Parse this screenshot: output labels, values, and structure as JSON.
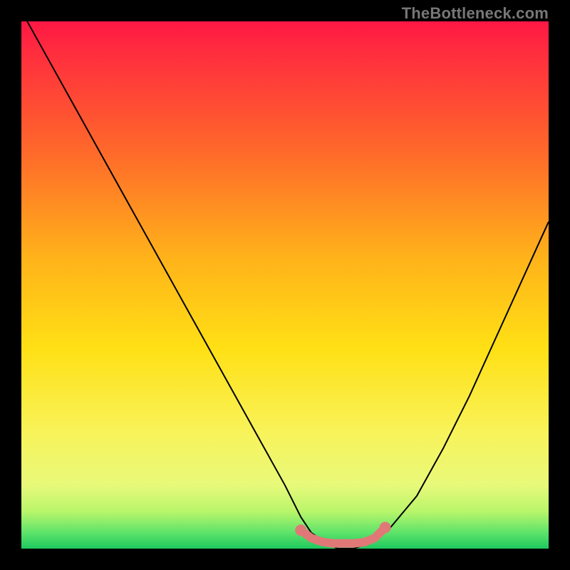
{
  "watermark": "TheBottleneck.com",
  "chart_data": {
    "type": "line",
    "title": "",
    "xlabel": "",
    "ylabel": "",
    "xlim": [
      0,
      100
    ],
    "ylim": [
      0,
      100
    ],
    "series": [
      {
        "name": "bottleneck-curve",
        "x": [
          0,
          5,
          10,
          15,
          20,
          25,
          30,
          35,
          40,
          45,
          50,
          53,
          55,
          58,
          60,
          63,
          66,
          70,
          75,
          80,
          85,
          90,
          95,
          100
        ],
        "y": [
          102,
          93,
          84,
          75,
          66,
          57,
          48,
          39,
          30,
          21,
          12,
          6,
          3,
          1,
          0,
          0,
          1,
          4,
          10,
          19,
          29,
          40,
          51,
          62
        ]
      }
    ],
    "highlight": {
      "name": "optimal-range",
      "color": "#e07878",
      "x": [
        53,
        55,
        57,
        59,
        61,
        63,
        65,
        67,
        69
      ],
      "y": [
        3.5,
        2.0,
        1.3,
        1.0,
        1.0,
        1.0,
        1.2,
        2.0,
        4.0
      ]
    },
    "gradient_stops": [
      {
        "offset": 0.0,
        "color": "#ff1744"
      },
      {
        "offset": 0.05,
        "color": "#ff2a3f"
      },
      {
        "offset": 0.25,
        "color": "#ff6a2a"
      },
      {
        "offset": 0.45,
        "color": "#ffb31a"
      },
      {
        "offset": 0.62,
        "color": "#ffe015"
      },
      {
        "offset": 0.78,
        "color": "#f8f35a"
      },
      {
        "offset": 0.88,
        "color": "#e8f97a"
      },
      {
        "offset": 0.93,
        "color": "#b8f56a"
      },
      {
        "offset": 0.97,
        "color": "#5de36a"
      },
      {
        "offset": 1.0,
        "color": "#1ec95e"
      }
    ]
  }
}
